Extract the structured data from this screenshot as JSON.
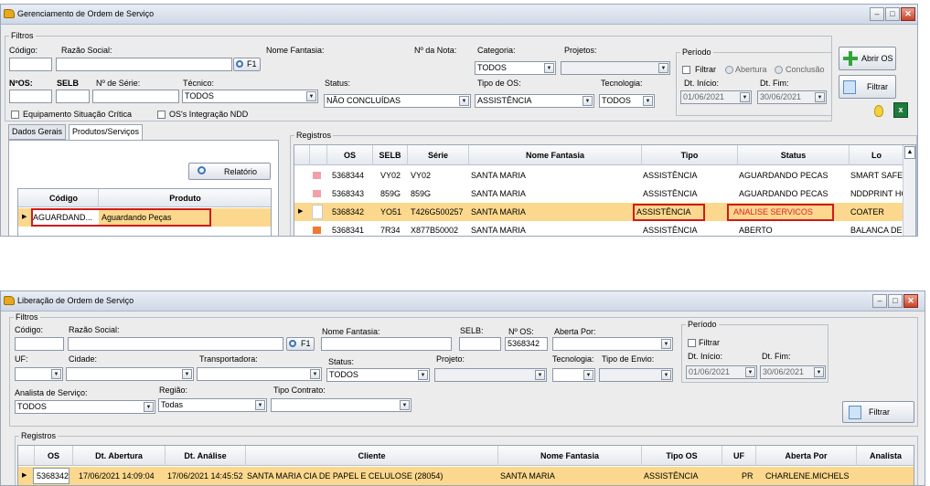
{
  "colors": {
    "selected_row": "#fbd88d",
    "highlight": "#d11a1a",
    "status_red": "#e0202a",
    "pink_marker": "#f2a0a8",
    "orange_marker": "#f07a32"
  },
  "win1": {
    "title": "Gerenciamento de Ordem de Serviço",
    "filtros": {
      "legend": "Filtros",
      "codigo_label": "Código:",
      "razao_label": "Razão Social:",
      "fantasia_label": "Nome Fantasia:",
      "nota_label": "Nº da Nota:",
      "categoria_label": "Categoria:",
      "categoria_value": "TODOS",
      "projetos_label": "Projetos:",
      "f1_label": "F1",
      "nos_label": "NºOS:",
      "selb_label": "SELB",
      "serie_label": "Nº de Série:",
      "tecnico_label": "Técnico:",
      "tecnico_value": "TODOS",
      "status_label": "Status:",
      "status_value": "NÃO CONCLUÍDAS",
      "tipo_label": "Tipo de OS:",
      "tipo_value": "ASSISTÊNCIA",
      "tecnologia_label": "Tecnologia:",
      "tecnologia_value": "TODOS",
      "equip_label": "Equipamento Situação Crítica",
      "integ_label": "OS's Integração NDD"
    },
    "periodo": {
      "legend": "Período",
      "filtrar": "Filtrar",
      "abertura": "Abertura",
      "conclusao": "Conclusão",
      "inicio_label": "Dt. Início:",
      "fim_label": "Dt. Fim:",
      "inicio_value": "01/06/2021",
      "fim_value": "30/06/2021"
    },
    "buttons": {
      "abrir_os": "Abrir OS",
      "filtrar": "Filtrar",
      "relatorio": "Relatório"
    },
    "tabs": [
      "Dados Gerais",
      "Produtos/Serviços"
    ],
    "produtos": {
      "headers": [
        "Código",
        "Produto"
      ],
      "rows": [
        {
          "codigo": "AGUARDAND...",
          "produto": "Aguardando Peças"
        }
      ]
    },
    "registros": {
      "legend": "Registros",
      "headers": [
        "OS",
        "SELB",
        "Série",
        "Nome Fantasia",
        "Tipo",
        "Status",
        "Lo"
      ],
      "rows": [
        {
          "os": "5368344",
          "selb": "VY02",
          "serie": "VY02",
          "fantasia": "SANTA MARIA",
          "tipo": "ASSISTÊNCIA",
          "status": "AGUARDANDO PECAS",
          "local": "SMART SAFER"
        },
        {
          "os": "5368343",
          "selb": "859G",
          "serie": "859G",
          "fantasia": "SANTA MARIA",
          "tipo": "ASSISTÊNCIA",
          "status": "AGUARDANDO PECAS",
          "local": "NDDPRINT HC"
        },
        {
          "os": "5368342",
          "selb": "YO51",
          "serie": "T426G500257",
          "fantasia": "SANTA MARIA",
          "tipo": "ASSISTÊNCIA",
          "status": "ANALISE SERVICOS",
          "local": "COATER"
        },
        {
          "os": "5368341",
          "selb": "7R34",
          "serie": "X877B50002",
          "fantasia": "SANTA MARIA",
          "tipo": "ASSISTÊNCIA",
          "status": "ABERTO",
          "local": "BALANCA DE"
        }
      ]
    }
  },
  "win2": {
    "title": "Liberação de Ordem de Serviço",
    "filtros": {
      "legend": "Filtros",
      "codigo_label": "Código:",
      "razao_label": "Razão Social:",
      "fantasia_label": "Nome Fantasia:",
      "selb_label": "SELB:",
      "nos_label": "Nº OS:",
      "nos_value": "5368342",
      "aberta_label": "Aberta Por:",
      "f1_label": "F1",
      "uf_label": "UF:",
      "cidade_label": "Cidade:",
      "transp_label": "Transportadora:",
      "status_label": "Status:",
      "status_value": "TODOS",
      "projeto_label": "Projeto:",
      "tecnologia_label": "Tecnologia:",
      "envio_label": "Tipo de Envio:",
      "analista_label": "Analista de Serviço:",
      "analista_value": "TODOS",
      "regiao_label": "Região:",
      "regiao_value": "Todas",
      "contrato_label": "Tipo Contrato:"
    },
    "periodo": {
      "legend": "Período",
      "filtrar": "Filtrar",
      "inicio_label": "Dt. Início:",
      "fim_label": "Dt. Fim:",
      "inicio_value": "01/06/2021",
      "fim_value": "30/06/2021"
    },
    "buttons": {
      "filtrar": "Filtrar"
    },
    "registros": {
      "legend": "Registros",
      "headers": [
        "OS",
        "Dt. Abertura",
        "Dt. Análise",
        "Cliente",
        "Nome Fantasia",
        "Tipo OS",
        "UF",
        "Aberta Por",
        "Analista"
      ],
      "rows": [
        {
          "os": "5368342",
          "abertura": "17/06/2021 14:09:04",
          "analise": "17/06/2021 14:45:52",
          "cliente": "SANTA MARIA CIA DE PAPEL E CELULOSE (28054)",
          "fantasia": "SANTA MARIA",
          "tipo": "ASSISTÊNCIA",
          "uf": "PR",
          "aberta_por": "CHARLENE.MICHELS"
        }
      ]
    }
  }
}
